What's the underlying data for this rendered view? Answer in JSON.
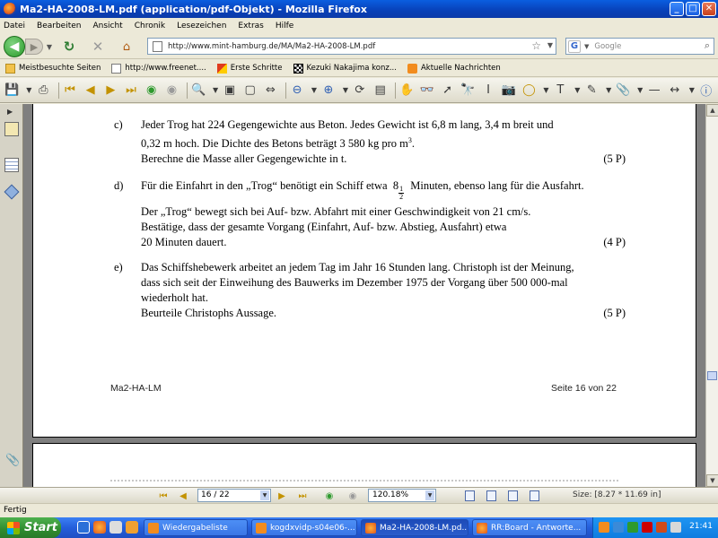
{
  "window": {
    "title": "Ma2-HA-2008-LM.pdf (application/pdf-Objekt) - Mozilla Firefox"
  },
  "menu": [
    "Datei",
    "Bearbeiten",
    "Ansicht",
    "Chronik",
    "Lesezeichen",
    "Extras",
    "Hilfe"
  ],
  "nav": {
    "url": "http://www.mint-hamburg.de/MA/Ma2-HA-2008-LM.pdf",
    "search_placeholder": "Google"
  },
  "bookmarks": [
    {
      "label": "Meistbesuchte Seiten",
      "icon": "folder-icon"
    },
    {
      "label": "http://www.freenet....",
      "icon": "page-icon"
    },
    {
      "label": "Erste Schritte",
      "icon": "firefox-icon"
    },
    {
      "label": "Kezuki Nakajima konz...",
      "icon": "checker-icon"
    },
    {
      "label": "Aktuelle Nachrichten",
      "icon": "rss-icon"
    }
  ],
  "document": {
    "task_c": {
      "label": "c)",
      "line1": "Jeder Trog hat 224 Gegengewichte aus Beton. Jedes Gewicht ist 6,8 m lang, 3,4 m breit und",
      "line2_pre": "0,32 m hoch. Die Dichte des Betons beträgt 3 580 kg pro m",
      "line2_sup": "3",
      "line2_post": ".",
      "line3": "Berechne die Masse aller Gegengewichte in t.",
      "points": "(5 P)"
    },
    "task_d": {
      "label": "d)",
      "line1_pre": "Für die Einfahrt in den „Trog“ benötigt ein Schiff etwa",
      "frac_whole": "8",
      "frac_num": "1",
      "frac_den": "2",
      "line1_post": "Minuten, ebenso lang für die Ausfahrt.",
      "line2": "Der „Trog“ bewegt sich bei Auf- bzw. Abfahrt mit einer Geschwindigkeit von 21 cm/s.",
      "line3": "Bestätige, dass der gesamte Vorgang (Einfahrt, Auf- bzw. Abstieg, Ausfahrt) etwa",
      "line4": "20 Minuten dauert.",
      "points": "(4 P)"
    },
    "task_e": {
      "label": "e)",
      "line1": "Das Schiffshebewerk arbeitet an jedem Tag im Jahr 16 Stunden lang. Christoph ist der Meinung,",
      "line2": "dass sich seit der Einweihung des Bauwerks im Dezember 1975 der Vorgang über 500 000-mal",
      "line3": "wiederholt hat.",
      "line4": "Beurteile Christophs Aussage.",
      "points": "(5 P)"
    },
    "footer_left": "Ma2-HA-LM",
    "footer_right": "Seite 16 von 22"
  },
  "pdf_nav": {
    "page": "16 / 22",
    "zoom": "120.18%",
    "size": "Size: [8.27 * 11.69 in]"
  },
  "status": "Fertig",
  "taskbar": {
    "start": "Start",
    "tasks": [
      {
        "label": "Wiedergabeliste",
        "active": false
      },
      {
        "label": "kogdxvidp-s04e06-...",
        "active": false
      },
      {
        "label": "Ma2-HA-2008-LM.pd...",
        "active": true
      },
      {
        "label": "RR:Board - Antworte...",
        "active": false
      }
    ],
    "clock": "21:41"
  }
}
